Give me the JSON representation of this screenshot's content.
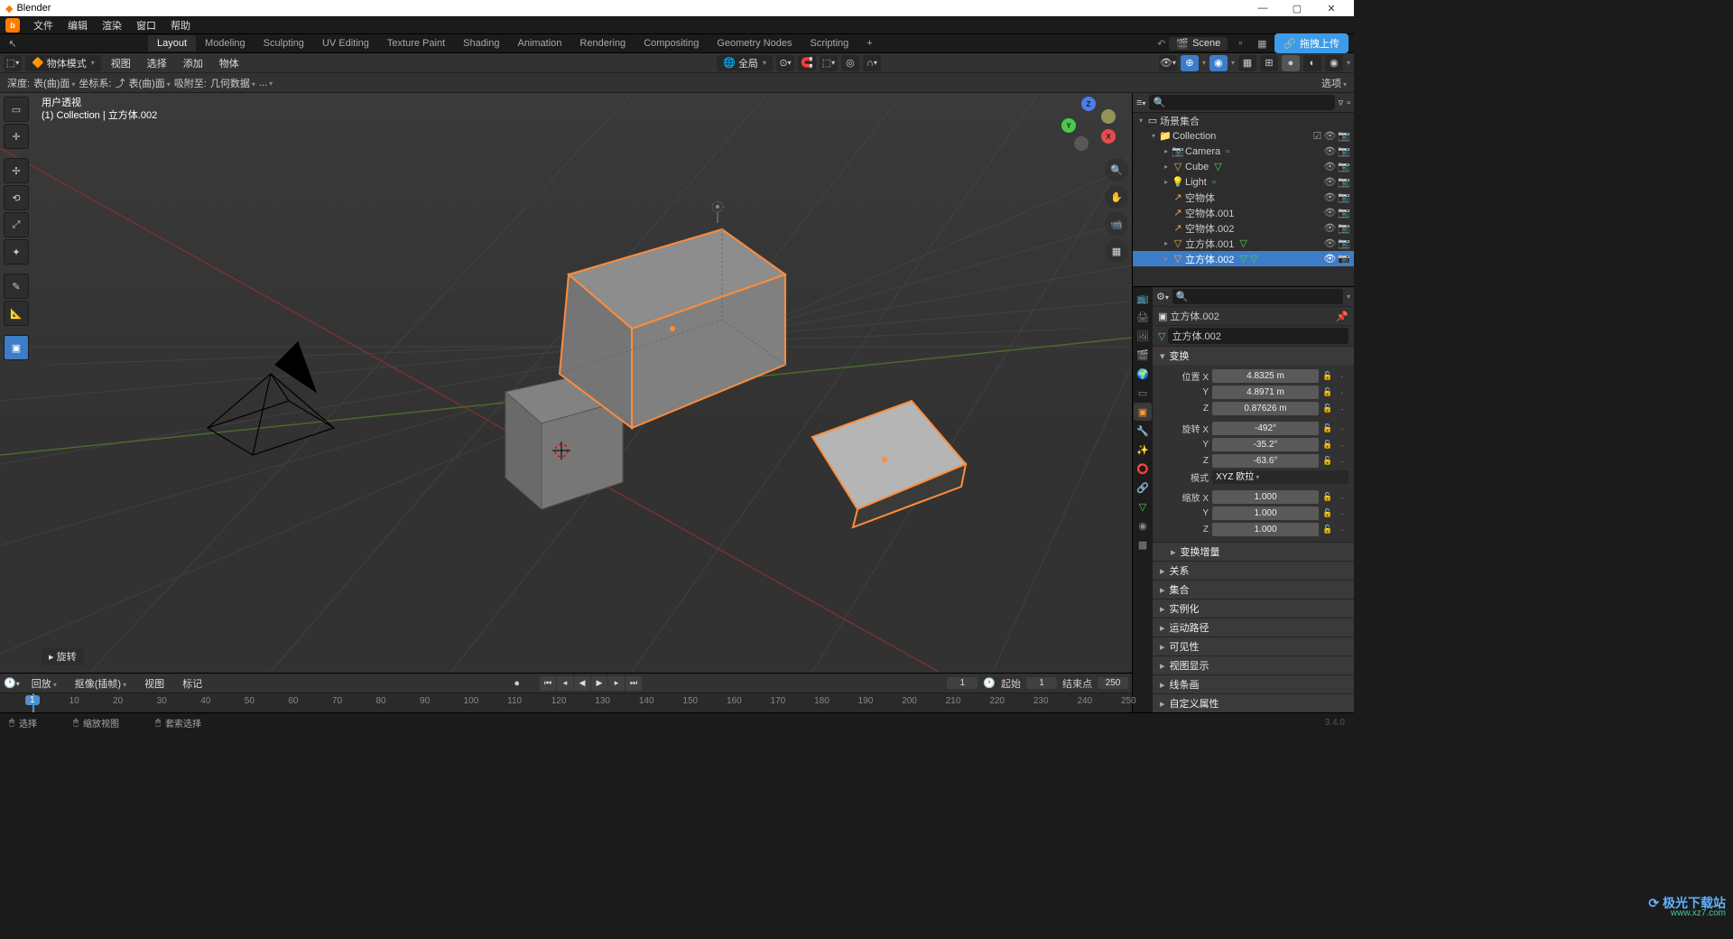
{
  "app_title": "Blender",
  "menus": [
    "文件",
    "编辑",
    "渲染",
    "窗口",
    "帮助"
  ],
  "workspaces": [
    "Layout",
    "Modeling",
    "Sculpting",
    "UV Editing",
    "Texture Paint",
    "Shading",
    "Animation",
    "Rendering",
    "Compositing",
    "Geometry Nodes",
    "Scripting"
  ],
  "active_workspace": 0,
  "scene_label": "Scene",
  "upload_btn": "拖拽上传",
  "header": {
    "mode": "物体模式",
    "items": [
      "视图",
      "选择",
      "添加",
      "物体"
    ],
    "global": "全局"
  },
  "subheader": {
    "depth_label": "深度:",
    "depth_value": "表(曲)面",
    "coord_label": "坐标系:",
    "coord_value": "表(曲)面",
    "snap_label": "吸附至:",
    "snap_value": "几何数据"
  },
  "viewport": {
    "title": "用户透视",
    "subtitle": "(1) Collection | 立方体.002",
    "options": "选项",
    "last_op": "旋转"
  },
  "outliner": {
    "scene_coll": "场景集合",
    "items": [
      {
        "name": "Collection",
        "depth": 1,
        "icon": "📁",
        "color": "#e6a55a",
        "tri": "▾",
        "restrict": [
          "☑",
          "👁",
          "📷"
        ]
      },
      {
        "name": "Camera",
        "depth": 2,
        "icon": "📷",
        "color": "#e0d47a",
        "tri": "▸",
        "restrict": [
          "👁",
          "📷"
        ],
        "extra": "green"
      },
      {
        "name": "Cube",
        "depth": 2,
        "icon": "▽",
        "color": "#e6a55a",
        "tri": "▸",
        "restrict": [
          "👁",
          "📷"
        ],
        "extra": "tri"
      },
      {
        "name": "Light",
        "depth": 2,
        "icon": "💡",
        "color": "#e6a55a",
        "tri": "▸",
        "restrict": [
          "👁",
          "📷"
        ],
        "extra": "green"
      },
      {
        "name": "空物体",
        "depth": 2,
        "icon": "↗",
        "color": "#e6a55a",
        "restrict": [
          "👁",
          "📷"
        ]
      },
      {
        "name": "空物体.001",
        "depth": 2,
        "icon": "↗",
        "color": "#e6a55a",
        "restrict": [
          "👁",
          "📷"
        ]
      },
      {
        "name": "空物体.002",
        "depth": 2,
        "icon": "↗",
        "color": "#e6a55a",
        "restrict": [
          "👁",
          "📷"
        ]
      },
      {
        "name": "立方体.001",
        "depth": 2,
        "icon": "▽",
        "color": "#e6a55a",
        "tri": "▸",
        "restrict": [
          "👁",
          "📷"
        ],
        "extra": "tri"
      },
      {
        "name": "立方体.002",
        "depth": 2,
        "icon": "▽",
        "color": "#e6a55a",
        "tri": "▸",
        "restrict": [
          "👁",
          "📷"
        ],
        "extra": "tri2",
        "sel": true
      }
    ]
  },
  "props": {
    "object_name": "立方体.002",
    "data_name": "立方体.002",
    "transform_label": "变换",
    "loc_label": "位置",
    "loc": {
      "x": "4.8325 m",
      "y": "4.8971 m",
      "z": "0.87626 m"
    },
    "rot_label": "旋转",
    "rot": {
      "x": "-492°",
      "y": "-35.2°",
      "z": "-63.6°"
    },
    "rot_mode_label": "模式",
    "rot_mode": "XYZ 欧拉",
    "scale_label": "缩放",
    "scale": {
      "x": "1.000",
      "y": "1.000",
      "z": "1.000"
    },
    "panels": [
      "变换增量",
      "关系",
      "集合",
      "实例化",
      "运动路径",
      "可见性",
      "视图显示",
      "线条画",
      "自定义属性"
    ]
  },
  "timeline": {
    "playback": "回放",
    "keying": "抠像(插帧)",
    "view": "视图",
    "marker": "标记",
    "current": "1",
    "start_label": "起始",
    "start": "1",
    "end_label": "结束点",
    "end": "250",
    "ticks": [
      0,
      10,
      20,
      30,
      40,
      50,
      60,
      70,
      80,
      90,
      100,
      110,
      120,
      130,
      140,
      150,
      160,
      170,
      180,
      190,
      200,
      210,
      220,
      230,
      240,
      250
    ]
  },
  "status": {
    "select": "选择",
    "zoom": "缩放视图",
    "lasso": "套索选择"
  },
  "version": "3.4.0",
  "watermark_site": "www.xz7.com"
}
